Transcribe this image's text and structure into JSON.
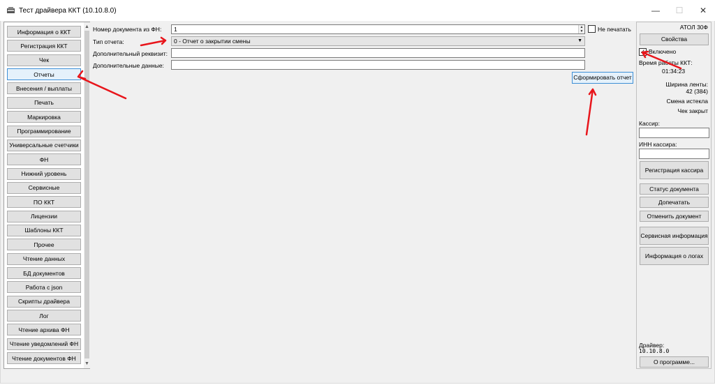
{
  "window": {
    "title": "Тест драйвера ККТ (10.10.8.0)"
  },
  "controls": {
    "minimize": "—",
    "maximize": "☐",
    "close": "✕"
  },
  "nav": {
    "items": [
      "Информация о ККТ",
      "Регистрация ККТ",
      "Чек",
      "Отчеты",
      "Внесения / выплаты",
      "Печать",
      "Маркировка",
      "Программирование",
      "Универсальные счетчики",
      "ФН",
      "Нижний уровень",
      "Сервисные",
      "ПО ККТ",
      "Лицензии",
      "Шаблоны ККТ",
      "Прочее",
      "Чтение данных",
      "БД документов",
      "Работа с json",
      "Скрипты драйвера",
      "Лог",
      "Чтение архива ФН",
      "Чтение уведомлений ФН",
      "Чтение документов ФН"
    ],
    "active": "Отчеты"
  },
  "form": {
    "doc_number_label": "Номер документа из ФН:",
    "doc_number_value": "1",
    "no_print_label": "Не печатать",
    "report_type_label": "Тип отчета:",
    "report_type_value": "0 - Отчет о закрытии смены",
    "extra_requisite_label": "Дополнительный реквизит:",
    "extra_data_label": "Дополнительные данные:",
    "generate_button": "Сформировать отчет"
  },
  "right": {
    "device": "АТОЛ 30Ф",
    "properties_button": "Свойства",
    "enabled_label": "Включено",
    "enabled_checked": true,
    "uptime_label": "Время работы ККТ:",
    "uptime_value": "01:34:23",
    "tape_width_label": "Ширина ленты:",
    "tape_width_value": "42 (384)",
    "shift_status": "Смена истекла",
    "receipt_status": "Чек закрыт",
    "cashier_label": "Кассир:",
    "cashier_inn_label": "ИНН кассира:",
    "register_cashier_button": "Регистрация кассира",
    "doc_status_button": "Статус документа",
    "reprint_button": "Допечатать",
    "cancel_doc_button": "Отменить документ",
    "service_info_button": "Сервисная информация",
    "log_info_button": "Информация о логах",
    "driver_label": "Драйвер:",
    "driver_version": "10.10.8.0",
    "about_button": "О программе..."
  },
  "annotation": {
    "arrow_color": "#e8151b"
  }
}
